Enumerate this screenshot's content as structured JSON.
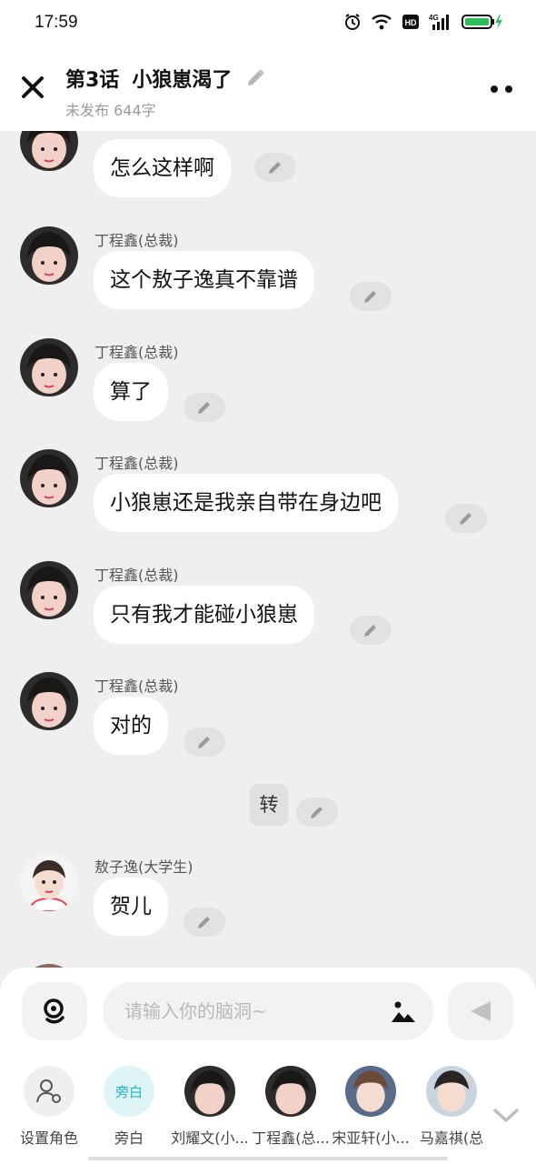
{
  "status_bar": {
    "time": "17:59",
    "icons": [
      "alarm-icon",
      "wifi-icon",
      "hd-icon",
      "signal-4g-icon",
      "battery-charging-icon"
    ]
  },
  "header": {
    "episode": "第3话",
    "title": "小狼崽渴了",
    "subtitle": "未发布 644字"
  },
  "messages": [
    {
      "speaker": "丁程鑫(总裁)",
      "text": "怎么这样啊"
    },
    {
      "speaker": "丁程鑫(总裁)",
      "text": "这个敖子逸真不靠谱"
    },
    {
      "speaker": "丁程鑫(总裁)",
      "text": "算了"
    },
    {
      "speaker": "丁程鑫(总裁)",
      "text": "小狼崽还是我亲自带在身边吧"
    },
    {
      "speaker": "丁程鑫(总裁)",
      "text": "只有我才能碰小狼崽"
    },
    {
      "speaker": "丁程鑫(总裁)",
      "text": "对的"
    },
    {
      "speaker": "",
      "text": "转"
    },
    {
      "speaker": "敖子逸(大学生)",
      "text": "贺儿"
    }
  ],
  "input": {
    "placeholder": "请输入你的脑洞~"
  },
  "roles": [
    {
      "label": "设置角色",
      "circle_text": ""
    },
    {
      "label": "旁白",
      "circle_text": "旁白"
    },
    {
      "label": "刘耀文(小...",
      "circle_text": ""
    },
    {
      "label": "丁程鑫(总...",
      "circle_text": ""
    },
    {
      "label": "宋亚轩(小...",
      "circle_text": ""
    },
    {
      "label": "马嘉祺(总",
      "circle_text": ""
    }
  ],
  "colors": {
    "chat_bg": "#efefef",
    "bubble": "#ffffff",
    "narrator": "#1bb4c6",
    "battery": "#2dbd5c"
  }
}
